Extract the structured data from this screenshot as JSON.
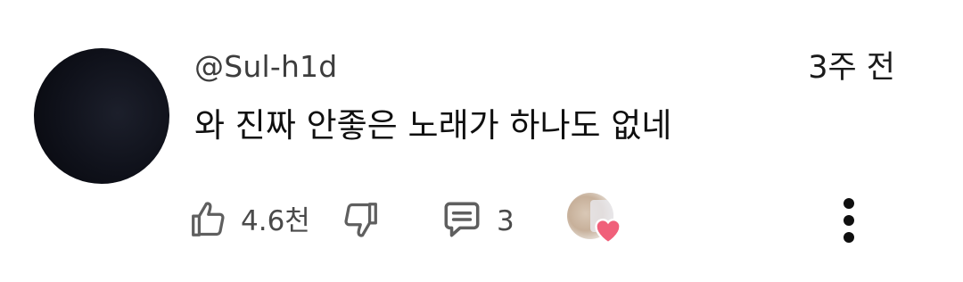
{
  "comment": {
    "author": "@Sul-h1d",
    "time": "3주 전",
    "text": "와 진짜 안좋은 노래가 하나도 없네",
    "like_count": "4.6천",
    "reply_count": "3"
  },
  "icons": {
    "like": "thumbs-up-icon",
    "dislike": "thumbs-down-icon",
    "reply": "comment-icon",
    "heart": "heart-icon",
    "more": "more-vertical-icon"
  },
  "colors": {
    "text": "#0f0f0f",
    "secondary_text": "#4a4a4a",
    "heart": "#f0607a",
    "icon": "#5f5f5f"
  }
}
